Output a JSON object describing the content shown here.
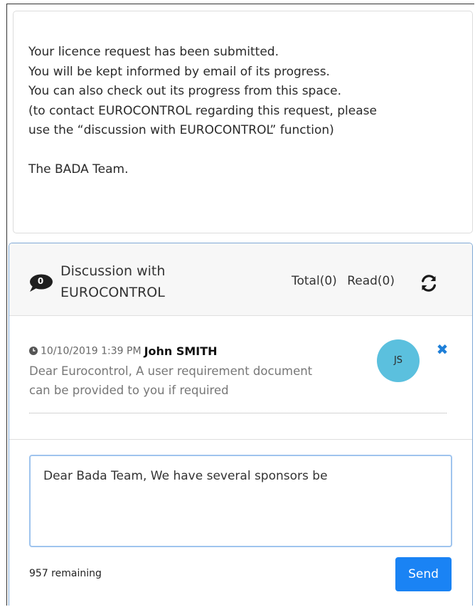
{
  "notice": {
    "lines": [
      "Your licence request has been submitted.",
      "You will be kept informed by email of its progress.",
      "You can also check out its progress from this space.",
      "(to contact EUROCONTROL regarding this request, please",
      "use the “discussion with EUROCONTROL” function)"
    ],
    "signoff": "The BADA Team."
  },
  "discussion": {
    "unread_badge": "0",
    "title_line1": "Discussion with",
    "title_line2": "EUROCONTROL",
    "total_label": "Total(0)",
    "read_label": "Read(0)",
    "icons": {
      "badge": "speech-bubble-icon",
      "refresh": "refresh-icon",
      "time": "clock-icon",
      "delete": "close-icon"
    },
    "colors": {
      "accent": "#1a83f4",
      "avatar": "#5bc0de",
      "card_border": "#7fa9d6"
    }
  },
  "message": {
    "timestamp": "10/10/2019 1:39 PM",
    "author": "John SMITH",
    "line1": "Dear Eurocontrol, A user requirement document",
    "line2": "can be provided to you if required",
    "avatar_initials": "JS",
    "delete_glyph": "✖"
  },
  "reply": {
    "value": "Dear Bada Team, We have several sponsors be",
    "remaining": "957 remaining",
    "send_label": "Send"
  }
}
